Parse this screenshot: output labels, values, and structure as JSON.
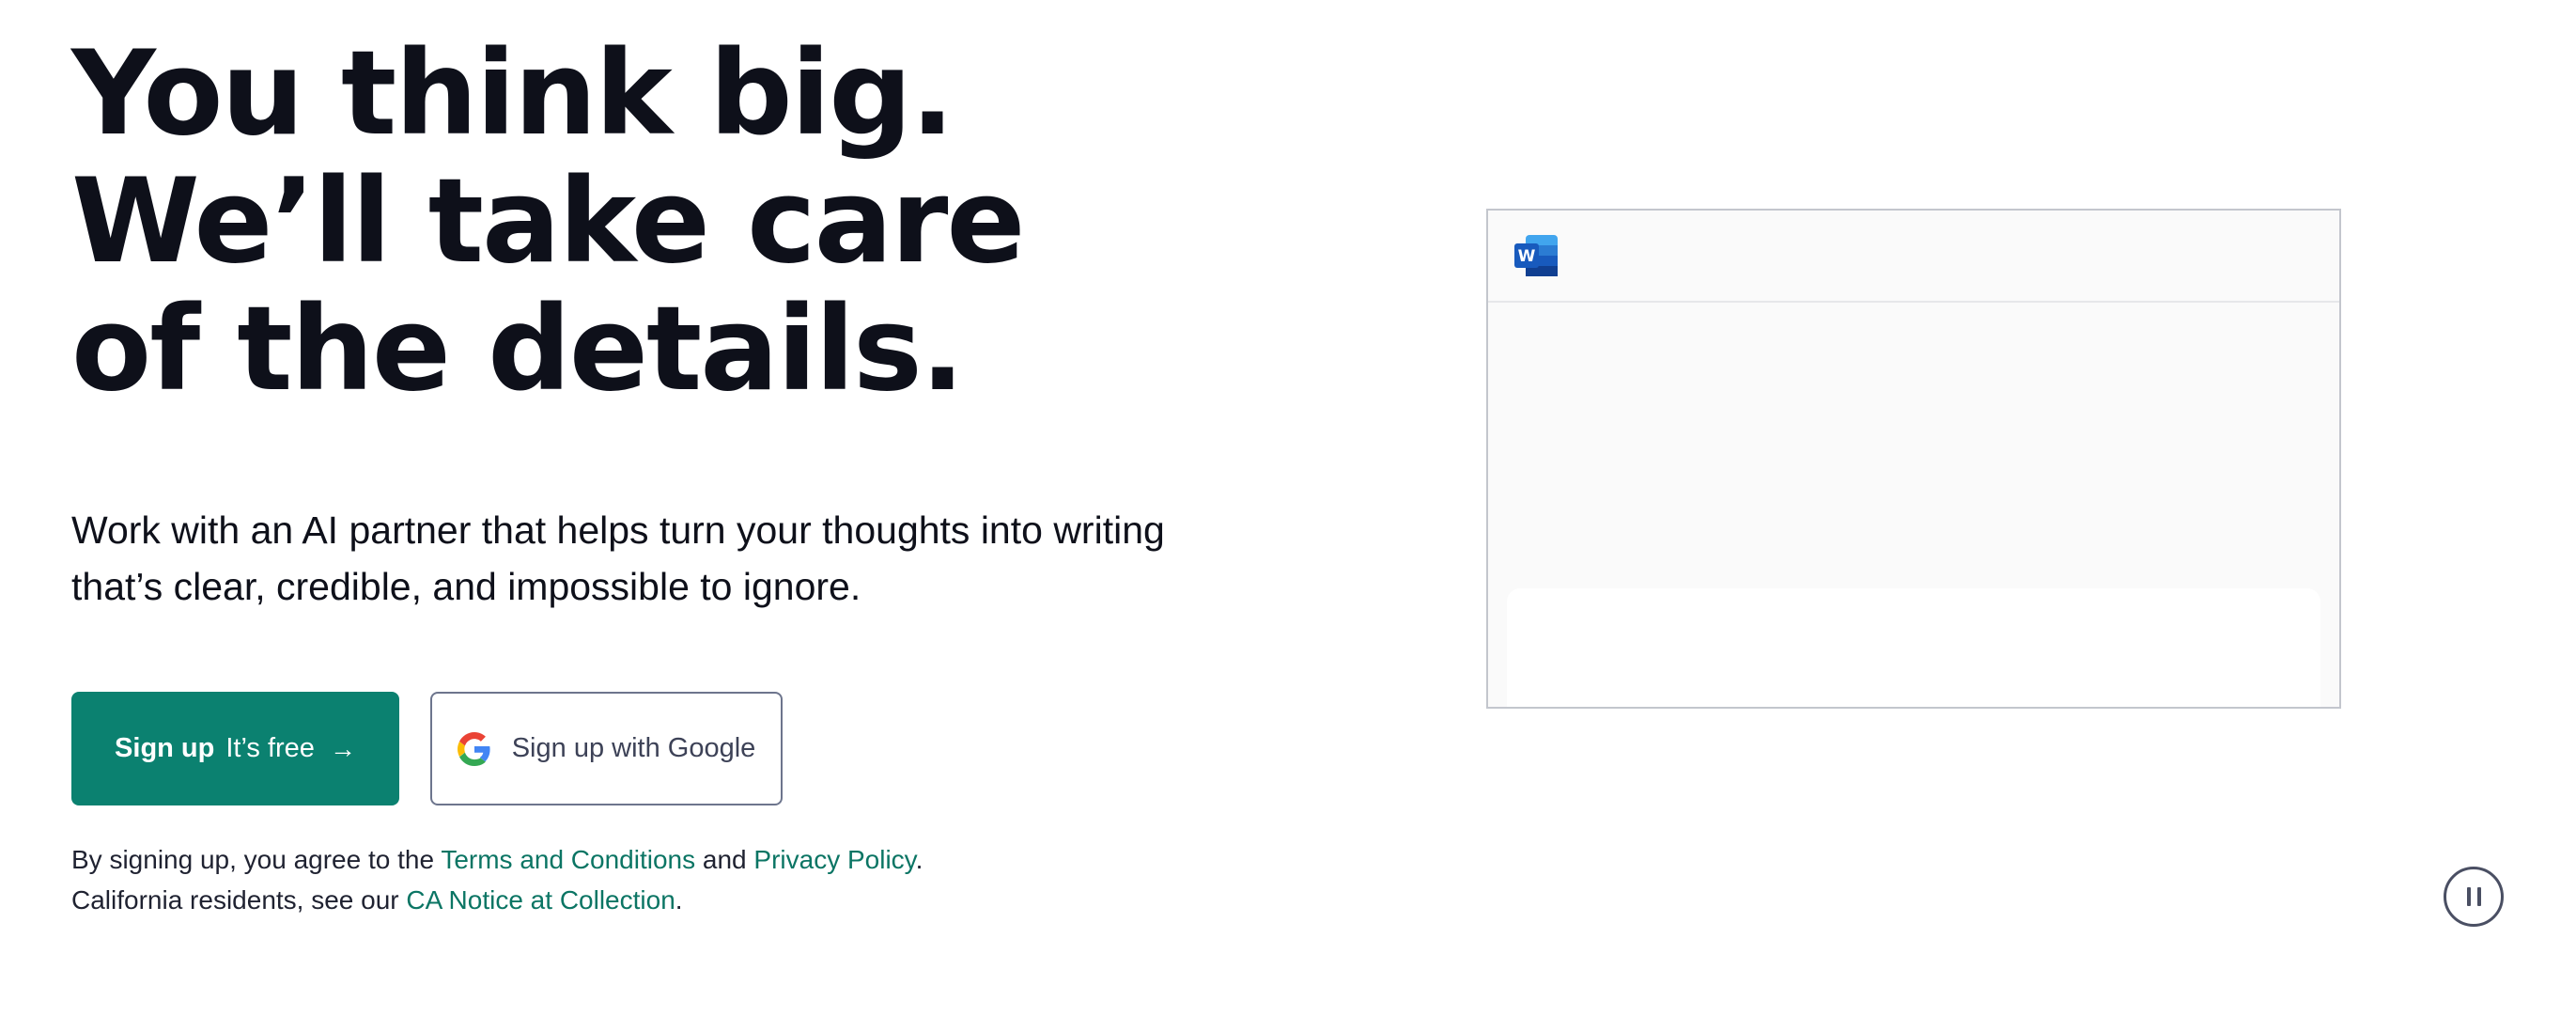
{
  "hero": {
    "headline": "You think big. We’ll take care of the details.",
    "subhead": "Work with an AI partner that helps turn your thoughts into writing that’s clear, credible, and impossible to ignore."
  },
  "cta": {
    "signup_strong": "Sign up",
    "signup_free": "It’s free",
    "signup_arrow": "→",
    "google_label": "Sign up with Google"
  },
  "legal": {
    "line1_prefix": "By signing up, you agree to the ",
    "terms_link": "Terms and Conditions",
    "and_text": " and ",
    "privacy_link": "Privacy Policy",
    "line1_suffix": ".",
    "line2_prefix": "California residents, see our ",
    "ca_notice_link": "CA Notice at Collection",
    "line2_suffix": "."
  },
  "preview": {
    "app_icon": "microsoft-word-icon"
  },
  "media": {
    "pause_icon": "pause-icon"
  },
  "colors": {
    "brand_green": "#0b8170",
    "link_green": "#0b7564",
    "headline": "#0e101a",
    "word_blue": "#185abd"
  }
}
